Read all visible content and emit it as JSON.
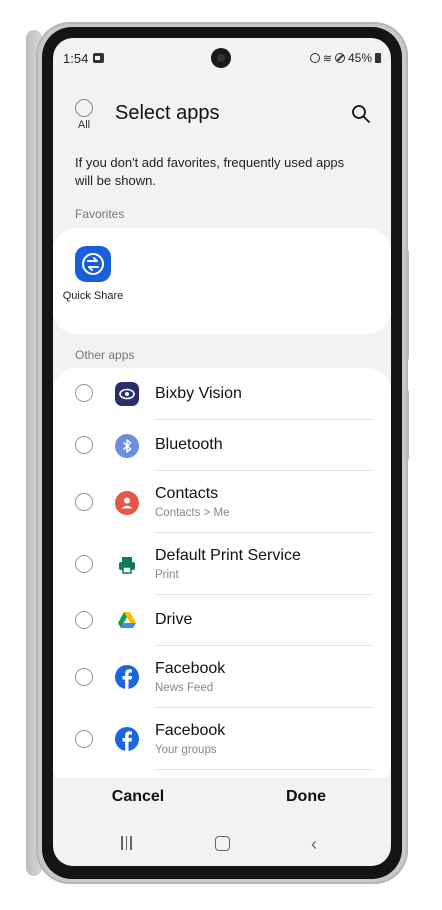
{
  "status": {
    "time": "1:54",
    "battery": "45%"
  },
  "header": {
    "all_label": "All",
    "title": "Select apps"
  },
  "info_text": "If you don't add favorites, frequently used apps will be shown.",
  "favorites": {
    "section_label": "Favorites",
    "items": [
      {
        "label": "Quick Share",
        "icon": "quick-share-icon"
      }
    ]
  },
  "other_apps": {
    "section_label": "Other apps",
    "items": [
      {
        "name": "Bixby Vision",
        "sub": "",
        "icon": "bixby-vision-icon",
        "color": "#2a2f6b"
      },
      {
        "name": "Bluetooth",
        "sub": "",
        "icon": "bluetooth-icon",
        "color": "#6b8fe0"
      },
      {
        "name": "Contacts",
        "sub": "Contacts > Me",
        "icon": "contacts-icon",
        "color": "#e5574b"
      },
      {
        "name": "Default Print Service",
        "sub": "Print",
        "icon": "printer-icon",
        "color": "#0f7a5a"
      },
      {
        "name": "Drive",
        "sub": "",
        "icon": "drive-icon",
        "color": "#fbbc04"
      },
      {
        "name": "Facebook",
        "sub": "News Feed",
        "icon": "facebook-icon",
        "color": "#1a66e0"
      },
      {
        "name": "Facebook",
        "sub": "Your groups",
        "icon": "facebook-icon",
        "color": "#1a66e0"
      }
    ]
  },
  "footer": {
    "cancel": "Cancel",
    "done": "Done"
  }
}
